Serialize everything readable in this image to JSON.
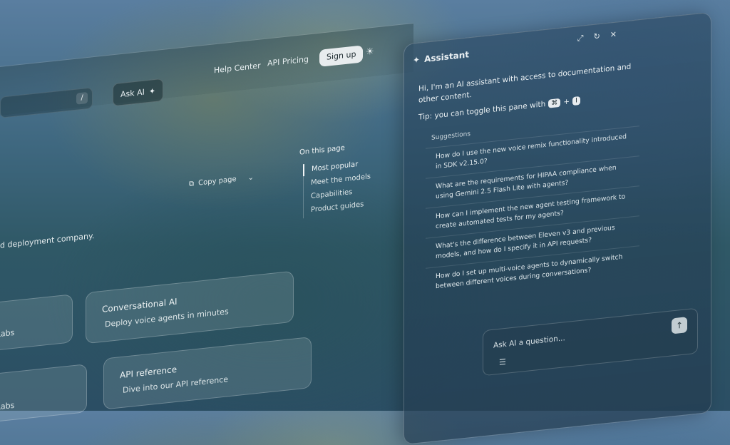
{
  "header": {
    "search_shortcut": "/",
    "ask_ai": "Ask AI",
    "links": [
      "Help Center",
      "API Pricing"
    ],
    "signup": "Sign up"
  },
  "page": {
    "copy_page": "Copy page",
    "intro_fragment": "d deployment company.",
    "on_this_page": "On this page",
    "toc": [
      "Most popular",
      "Meet the models",
      "Capabilities",
      "Product guides"
    ],
    "cards": [
      {
        "title": "",
        "subtitle": "enLabs"
      },
      {
        "title": "Conversational AI",
        "subtitle": "Deploy voice agents in minutes"
      },
      {
        "title": "",
        "subtitle": "enLabs"
      },
      {
        "title": "API reference",
        "subtitle": "Dive into our API reference"
      }
    ]
  },
  "assistant": {
    "title": "Assistant",
    "welcome": "Hi, I'm an AI assistant with access to documentation and other content.",
    "tip_prefix": "Tip: you can toggle this pane with",
    "tip_key1": "⌘",
    "tip_plus": "+",
    "tip_key2": "I",
    "suggestions_label": "Suggestions",
    "suggestions": [
      "How do I use the new voice remix functionality introduced in SDK v2.15.0?",
      "What are the requirements for HIPAA compliance when using Gemini 2.5 Flash Lite with agents?",
      "How can I implement the new agent testing framework to create automated tests for my agents?",
      "What's the difference between Eleven v3 and previous models, and how do I specify it in API requests?",
      "How do I set up multi-voice agents to dynamically switch between different voices during conversations?"
    ],
    "input_placeholder": "Ask AI a question..."
  }
}
